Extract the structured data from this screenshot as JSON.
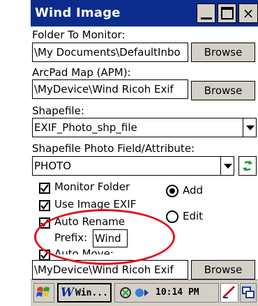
{
  "window": {
    "title": "Wind Image"
  },
  "form": {
    "folder_label": "Folder To Monitor:",
    "folder_value": "\\My Documents\\DefaultInbo",
    "browse_label": "Browse",
    "apm_label": "ArcPad Map (APM):",
    "apm_value": "\\MyDevice\\Wind Ricoh Exif",
    "shapefile_label": "Shapefile:",
    "shapefile_value": "EXIF_Photo_shp_file",
    "photo_field_label": "Shapefile Photo Field/Attribute:",
    "photo_field_value": "PHOTO",
    "refresh_icon": "refresh-icon",
    "options": {
      "monitor_folder": {
        "label": "Monitor Folder",
        "checked": true
      },
      "use_image_exif": {
        "label": "Use Image EXIF",
        "checked": true
      },
      "auto_rename": {
        "label": "Auto Rename",
        "checked": true
      },
      "auto_move": {
        "label": "Auto Move:",
        "checked": true
      }
    },
    "prefix_label": "Prefix:",
    "prefix_value": "Wind",
    "mode": {
      "add_label": "Add",
      "edit_label": "Edit",
      "selected": "Add"
    },
    "move_value": "\\MyDevice\\Wind Ricoh Exif"
  },
  "taskbar": {
    "start_icon": "windows-flag-icon",
    "task_label": "Win...",
    "time": "10:14 PM"
  },
  "colors": {
    "titlebar": "#0b2c8c",
    "highlight": "#e0141c",
    "button_face": "#d4d0c8"
  }
}
